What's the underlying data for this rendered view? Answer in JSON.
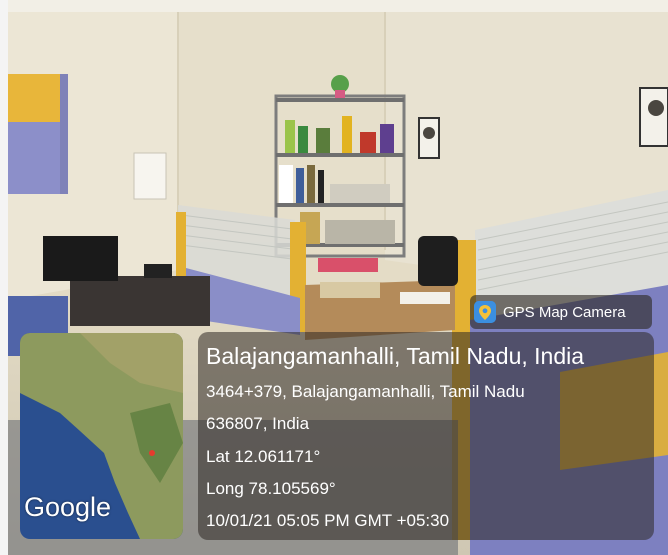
{
  "badge": {
    "app_name": "GPS Map Camera",
    "icon": "map-pin-icon",
    "icon_color": "#2f8fe0"
  },
  "location": {
    "title": "Balajangamanhalli, Tamil Nadu, India",
    "address_line_1": "3464+379, Balajangamanhalli, Tamil Nadu",
    "address_line_2": "636807, India",
    "latitude": "Lat 12.061171°",
    "longitude": "Long 78.105569°",
    "timestamp": "10/01/21 05:05 PM GMT +05:30"
  },
  "map": {
    "attribution": "Google",
    "land_color": "#8d9a5e",
    "sea_color": "#2a4f8f"
  }
}
